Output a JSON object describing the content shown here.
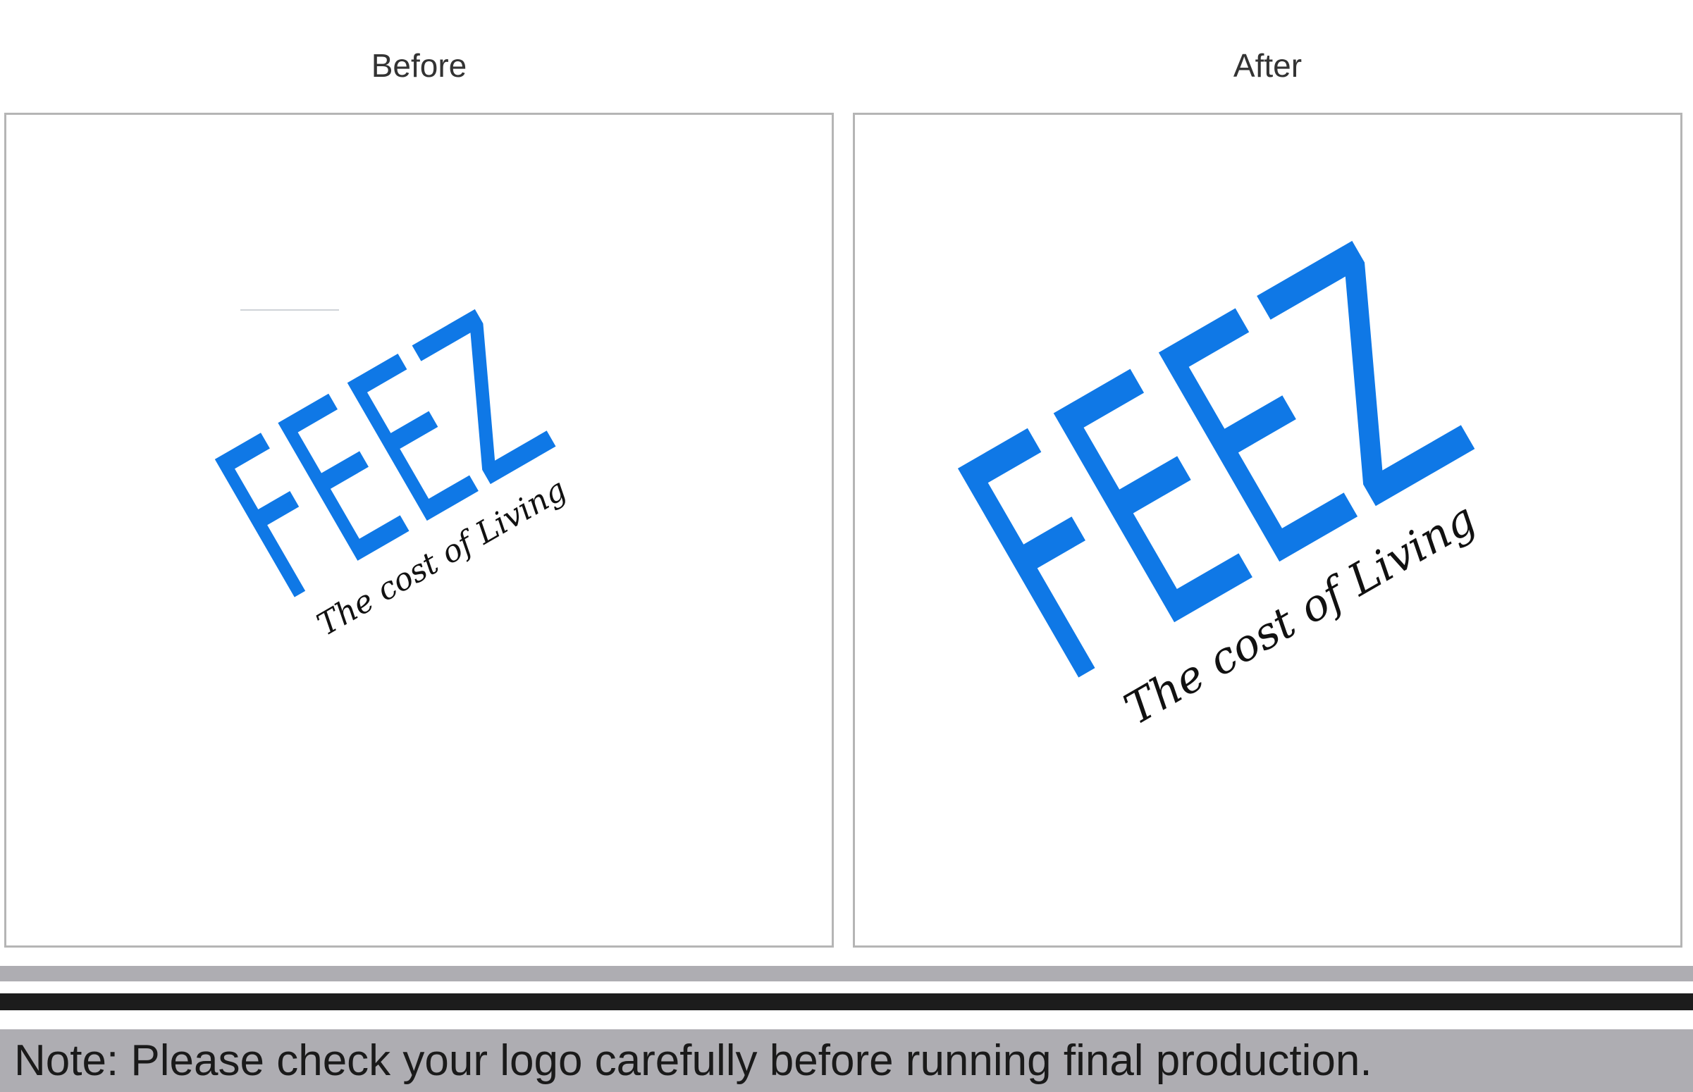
{
  "labels": {
    "before": "Before",
    "after": "After"
  },
  "logo": {
    "wordmark": "FEEZ",
    "tagline": "The cost of Living",
    "brand_color": "#0f78e6",
    "tagline_color": "#111111"
  },
  "note": {
    "text": "Note: Please check your logo carefully before running final production."
  },
  "colors": {
    "panel_border": "#b5b5b5",
    "bar_gray": "#aeadb2",
    "bar_black": "#1c1c1c"
  }
}
